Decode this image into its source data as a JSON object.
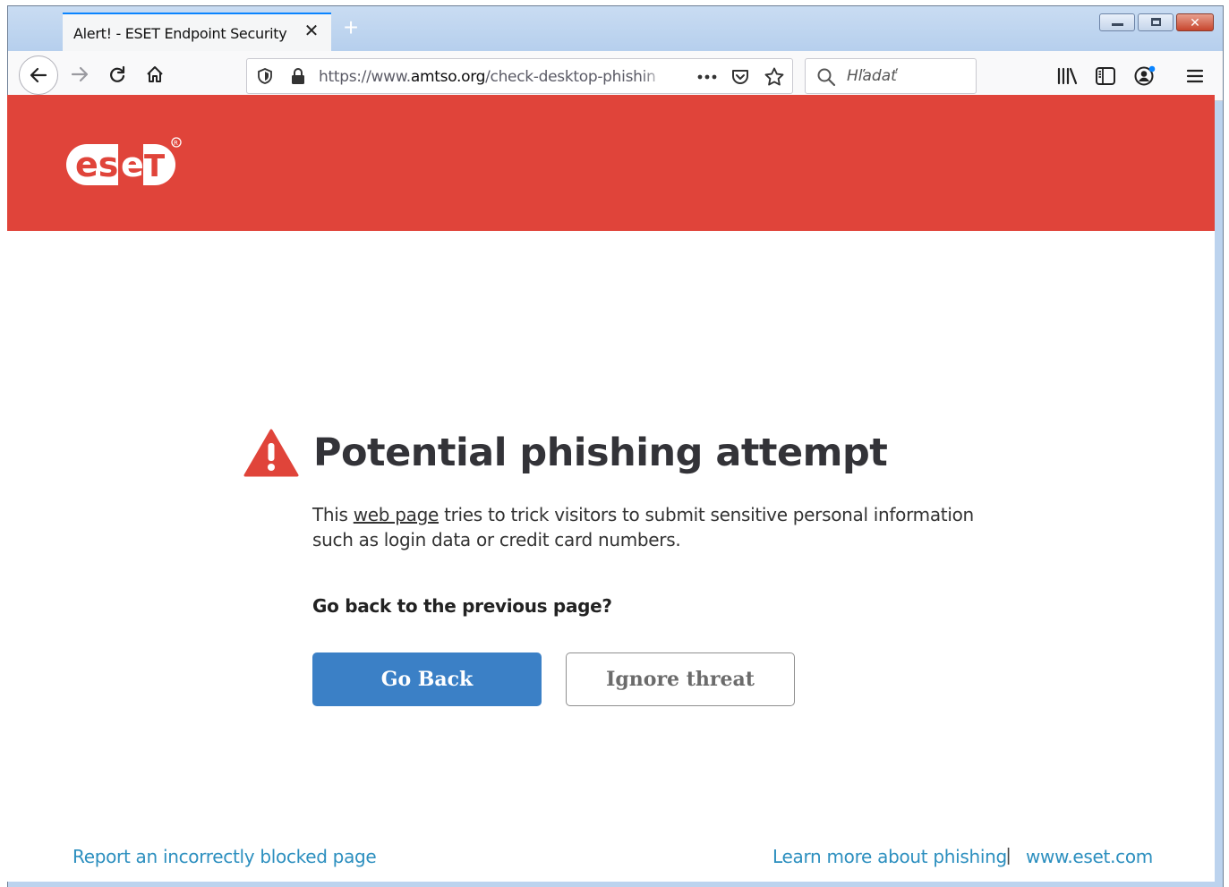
{
  "browser": {
    "tab": {
      "title": "Alert! - ESET Endpoint Security",
      "close_label": "✕"
    },
    "new_tab_label": "+",
    "url": {
      "prefix": "https://www.",
      "host": "amtso.org",
      "path": "/check-desktop-phishin"
    },
    "search": {
      "placeholder": "Hľadať"
    },
    "window_controls": {
      "close_label": "✕"
    }
  },
  "page": {
    "banner_color": "#e0443a",
    "logo_text": "eset",
    "title": "Potential phishing attempt",
    "description": {
      "before_link": "This ",
      "link": "web page",
      "after_link": " tries to trick visitors to submit sensitive personal information such as login data or credit card numbers."
    },
    "question": "Go back to the previous page?",
    "buttons": {
      "go_back": "Go Back",
      "ignore": "Ignore threat"
    },
    "footer": {
      "report": "Report an incorrectly blocked page",
      "learn_more": "Learn more about phishing",
      "separator": "|",
      "site": "www.eset.com"
    },
    "link_color": "#2c8fbf",
    "primary_color": "#3b80c6"
  }
}
